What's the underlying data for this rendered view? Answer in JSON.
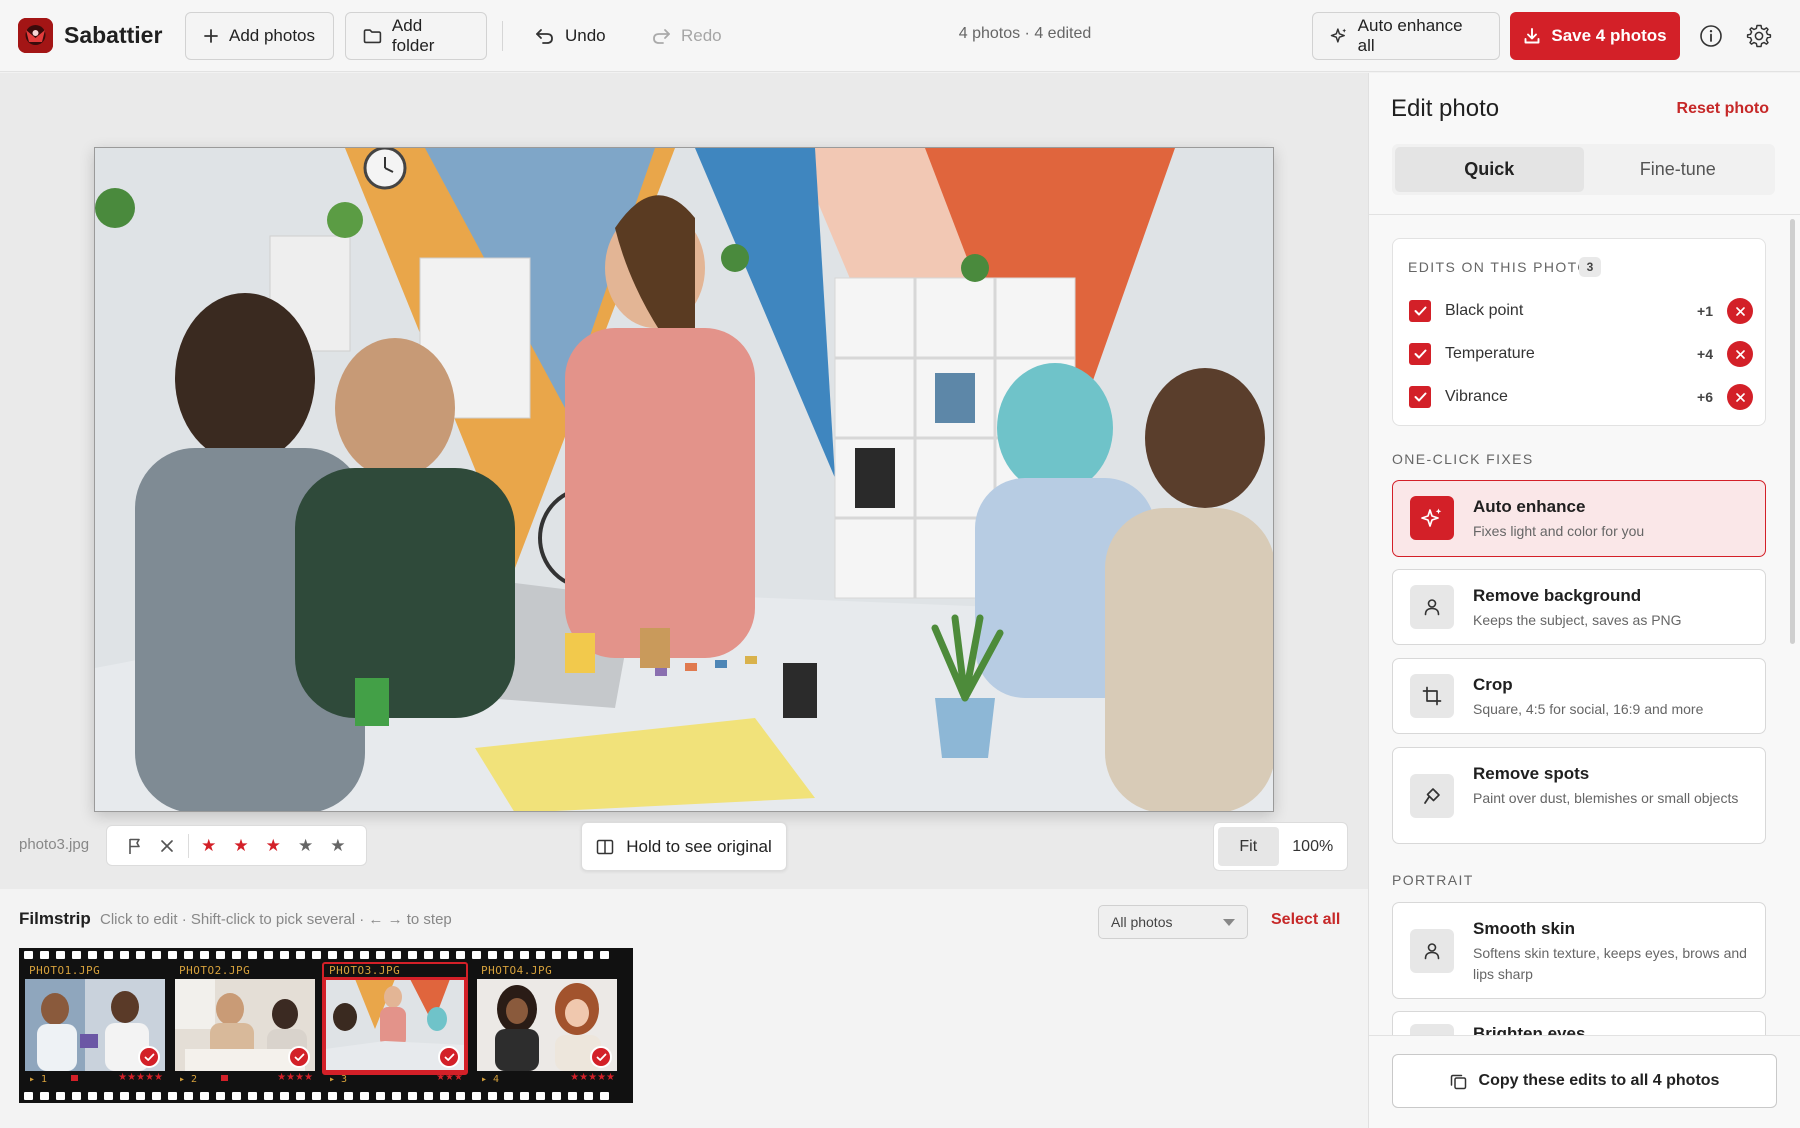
{
  "app": {
    "name": "Sabattier"
  },
  "toolbar": {
    "add_photos": "Add photos",
    "add_folder": "Add folder",
    "undo": "Undo",
    "redo": "Redo",
    "status": "4 photos · 4 edited",
    "auto_enhance_all": "Auto enhance all",
    "save": "Save 4 photos",
    "icons": [
      "plus-icon",
      "folder-icon",
      "undo-icon",
      "redo-icon",
      "sparkle-icon",
      "download-icon",
      "info-icon",
      "gear-icon"
    ]
  },
  "viewer": {
    "file_name": "photo3.jpg",
    "rating": 3,
    "max_rating": 5,
    "hold_original": "Hold to see original",
    "zoom_options": [
      "Fit",
      "100%"
    ],
    "zoom_selected": "Fit"
  },
  "filmstrip": {
    "title": "Filmstrip",
    "hint": "Click to edit · Shift-click to pick several · ← → to step",
    "filter": "All photos",
    "select_all": "Select all",
    "frames": [
      {
        "label": "PHOTO1.JPG",
        "num": "▸ 1",
        "stars": "★★★★★",
        "edited": true,
        "selected": false
      },
      {
        "label": "PHOTO2.JPG",
        "num": "▸ 2",
        "stars": "★★★★",
        "edited": true,
        "selected": false
      },
      {
        "label": "PHOTO3.JPG",
        "num": "▸ 3",
        "stars": "★★★",
        "edited": true,
        "selected": true
      },
      {
        "label": "PHOTO4.JPG",
        "num": "▸ 4",
        "stars": "★★★★★",
        "edited": true,
        "selected": false
      }
    ]
  },
  "panel": {
    "title": "Edit photo",
    "reset": "Reset photo",
    "tabs": [
      "Quick",
      "Fine-tune"
    ],
    "active_tab": "Quick",
    "edits_label": "EDITS ON THIS PHOTO",
    "edits_count": "3",
    "edits": [
      {
        "label": "Black point",
        "value": "+1",
        "checked": true
      },
      {
        "label": "Temperature",
        "value": "+4",
        "checked": true
      },
      {
        "label": "Vibrance",
        "value": "+6",
        "checked": true
      }
    ],
    "one_click_label": "ONE-CLICK FIXES",
    "fixes": [
      {
        "title": "Auto enhance",
        "desc": "Fixes light and color for you",
        "icon": "sparkle-icon",
        "active": true
      },
      {
        "title": "Remove background",
        "desc": "Keeps the subject, saves as PNG",
        "icon": "person-icon",
        "active": false
      },
      {
        "title": "Crop",
        "desc": "Square, 4:5 for social, 16:9 and more",
        "icon": "crop-icon",
        "active": false
      },
      {
        "title": "Remove spots",
        "desc": "Paint over dust, blemishes or small objects",
        "icon": "brush-icon",
        "active": false
      }
    ],
    "portrait_label": "PORTRAIT",
    "portrait": [
      {
        "title": "Smooth skin",
        "desc": "Softens skin texture, keeps eyes, brows and lips sharp",
        "icon": "person-icon"
      },
      {
        "title": "Brighten eyes",
        "desc": "",
        "icon": "eye-icon"
      }
    ],
    "copy_button": "Copy these edits to all 4 photos"
  },
  "colors": {
    "accent": "#d32028",
    "panel_bg": "#f8f8f8",
    "film": "#111111"
  }
}
